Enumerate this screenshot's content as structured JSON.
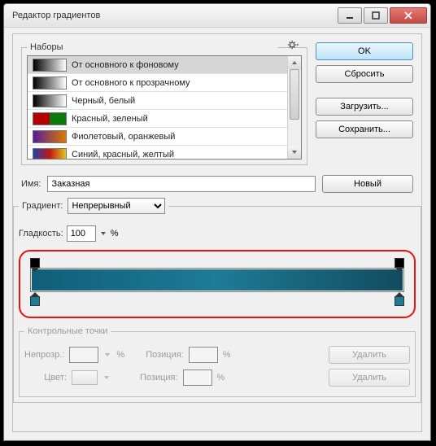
{
  "window": {
    "title": "Редактор градиентов"
  },
  "buttons": {
    "ok": "OK",
    "cancel": "Сбросить",
    "load": "Загрузить...",
    "save": "Сохранить...",
    "new": "Новый",
    "delete1": "Удалить",
    "delete2": "Удалить"
  },
  "presets": {
    "legend": "Наборы",
    "gear_icon": "gear",
    "items": [
      {
        "label": "От основного к фоновому",
        "swatch": "sw1"
      },
      {
        "label": "От основного к прозрачному",
        "swatch": "sw2"
      },
      {
        "label": "Черный, белый",
        "swatch": "sw3"
      },
      {
        "label": "Красный, зеленый",
        "swatch": "sw4"
      },
      {
        "label": "Фиолетовый, оранжевый",
        "swatch": "sw5"
      },
      {
        "label": "Синий, красный, желтый",
        "swatch": "sw6"
      }
    ]
  },
  "name": {
    "label": "Имя:",
    "value": "Заказная"
  },
  "gradient": {
    "type_label": "Градиент:",
    "type_value": "Непрерывный",
    "smooth_label": "Гладкость:",
    "smooth_value": "100",
    "percent": "%"
  },
  "controlpoints": {
    "legend": "Контрольные точки",
    "opacity_label": "Непрозр.:",
    "color_label": "Цвет:",
    "position_label": "Позиция:",
    "opacity_value": "",
    "pos1_value": "",
    "pos2_value": ""
  },
  "colors": {
    "highlight_border": "#e11",
    "grad_start": "#0f5e79",
    "grad_mid": "#1e7b96",
    "grad_end": "#114b5f"
  }
}
